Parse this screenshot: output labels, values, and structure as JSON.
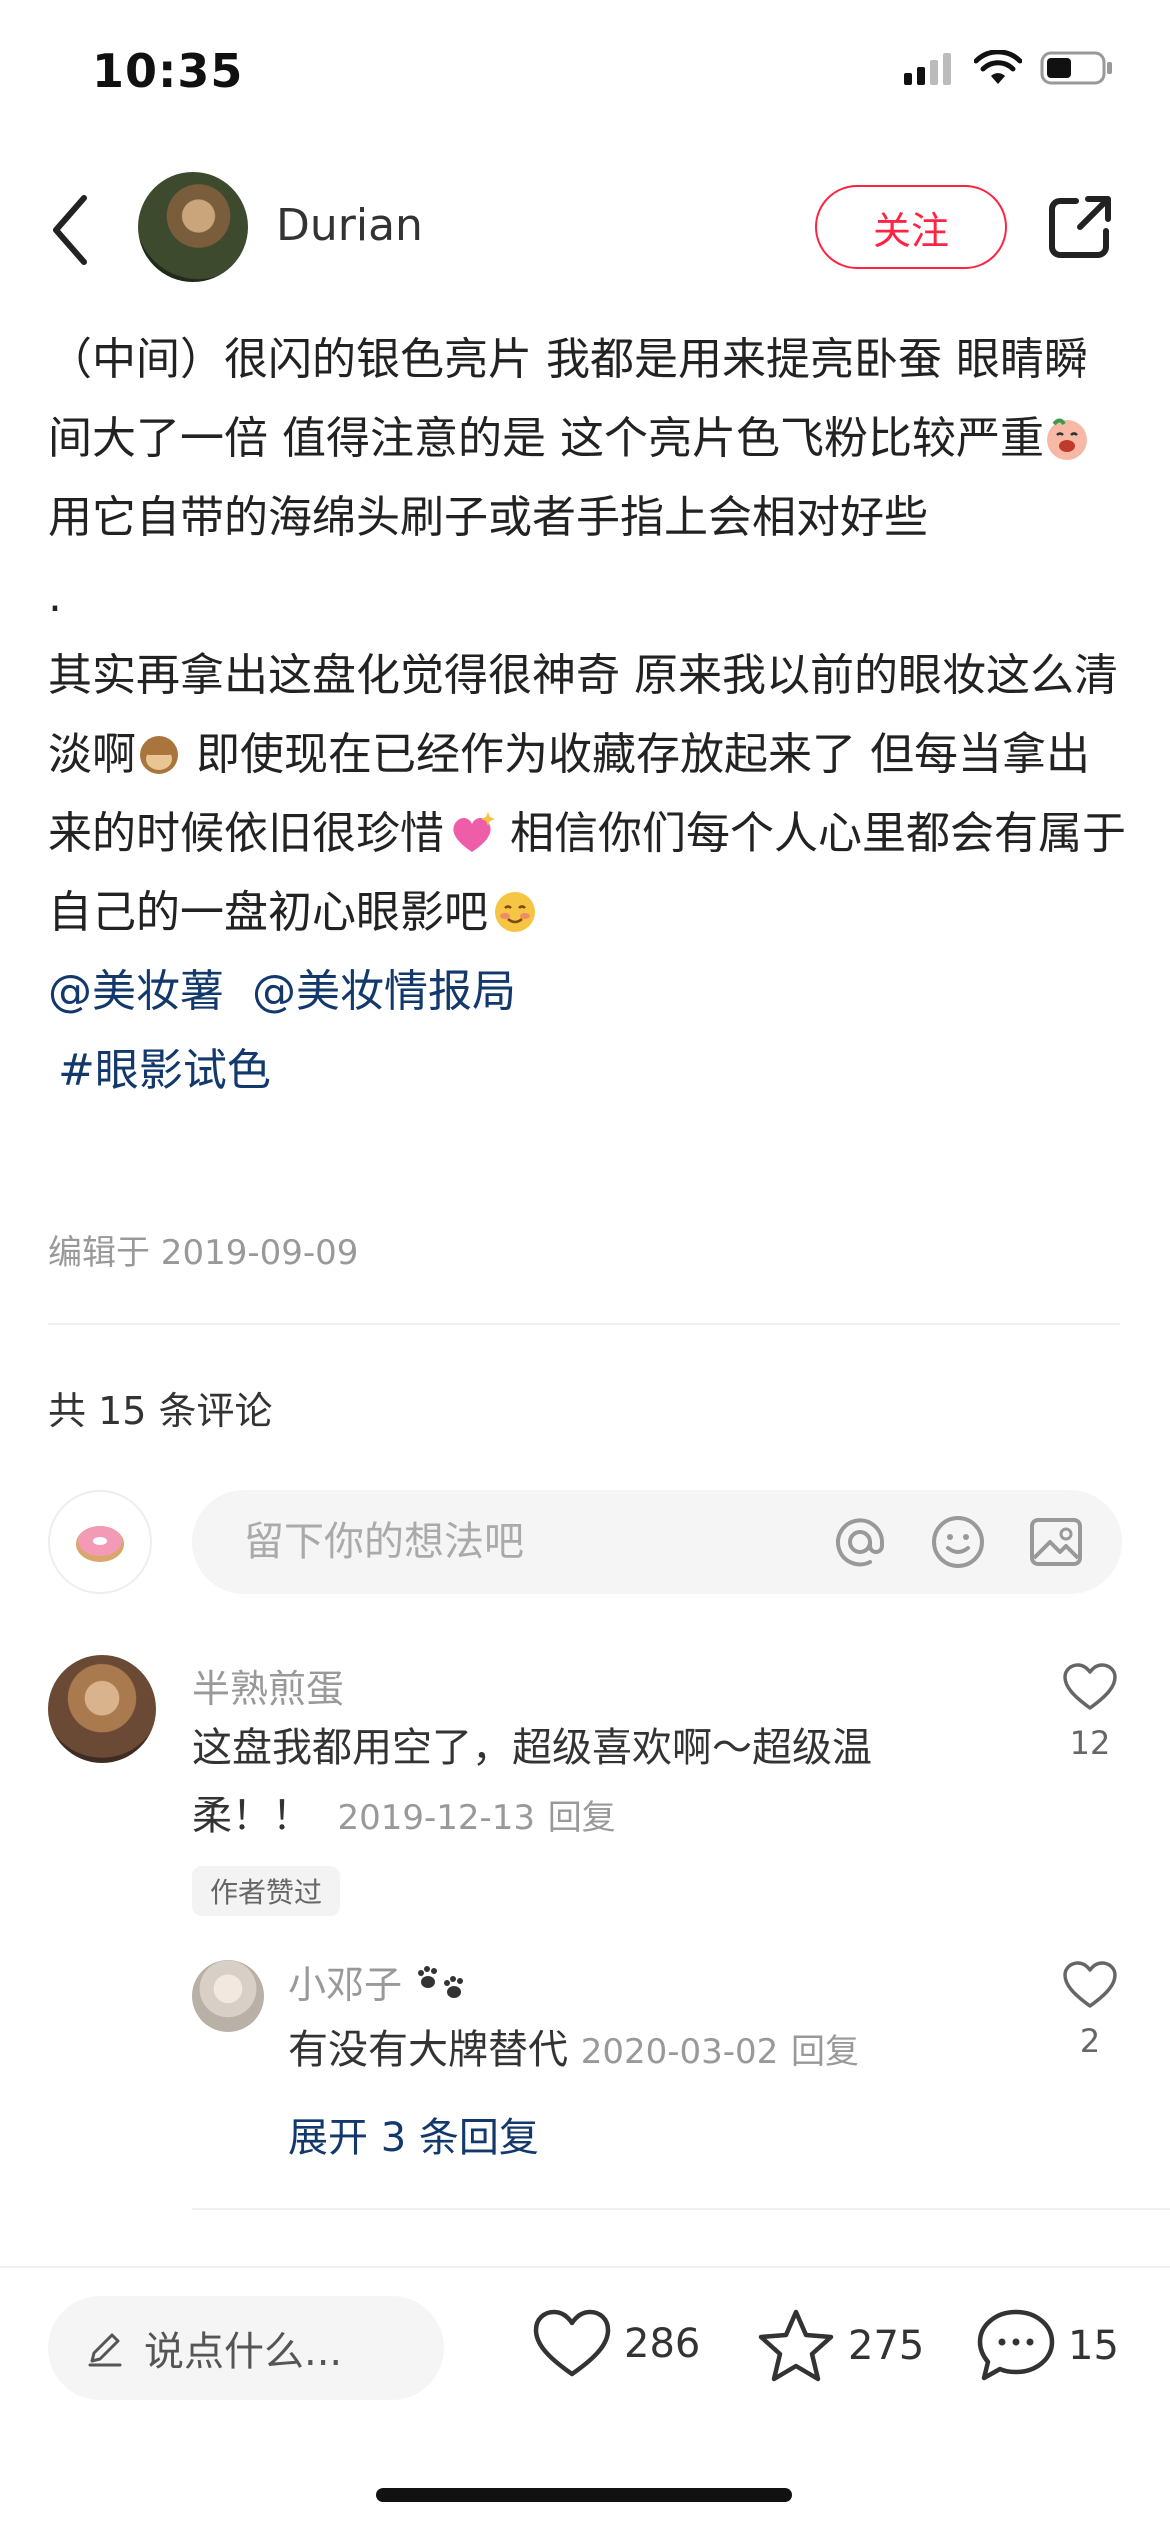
{
  "status_bar": {
    "time": "10:35"
  },
  "header": {
    "author_name": "Durian",
    "follow_label": "关注"
  },
  "post": {
    "paragraph1": "（中间）很闪的银色亮片  我都是用来提亮卧蚕 眼睛瞬间大了一倍 值得注意的是 这个亮片色飞粉比较严重",
    "paragraph1_b": "用它自带的海绵头刷子或者手指上会相对好些",
    "dot": ".",
    "paragraph2_a": "其实再拿出这盘化觉得很神奇 原来我以前的眼妆这么清淡啊",
    "paragraph2_b": " 即使现在已经作为收藏存放起来了 但每当拿出来的时候依旧很珍惜",
    "paragraph2_c": " 相信你们每个人心里都会有属于自己的一盘初心眼影吧",
    "mention1": "@美妆薯",
    "mention2": "@美妆情报局",
    "hashtag": "#眼影试色",
    "edit_date": "编辑于 2019-09-09"
  },
  "comments_section": {
    "count_label": "共 15 条评论",
    "input_placeholder": "留下你的想法吧"
  },
  "comments": [
    {
      "name": "半熟煎蛋",
      "text_line1": "这盘我都用空了，超级喜欢啊～超级温",
      "text_line2": "柔！！",
      "date": "2019-12-13",
      "reply_label": "回复",
      "likes": "12",
      "badge": "作者赞过"
    },
    {
      "name": "小邓子",
      "text": "有没有大牌替代",
      "date": "2020-03-02",
      "reply_label": "回复",
      "likes": "2",
      "expand_label": "展开 3 条回复"
    }
  ],
  "bottom_bar": {
    "say_placeholder": "说点什么...",
    "likes": "286",
    "favorites": "275",
    "comments": "15"
  },
  "colors": {
    "accent": "#ff2442",
    "link": "#13386c"
  },
  "icons": [
    "back-arrow-icon",
    "share-icon",
    "at-icon",
    "emoji-icon",
    "image-icon",
    "heart-icon",
    "star-icon",
    "comment-bubble-icon",
    "pencil-icon"
  ]
}
